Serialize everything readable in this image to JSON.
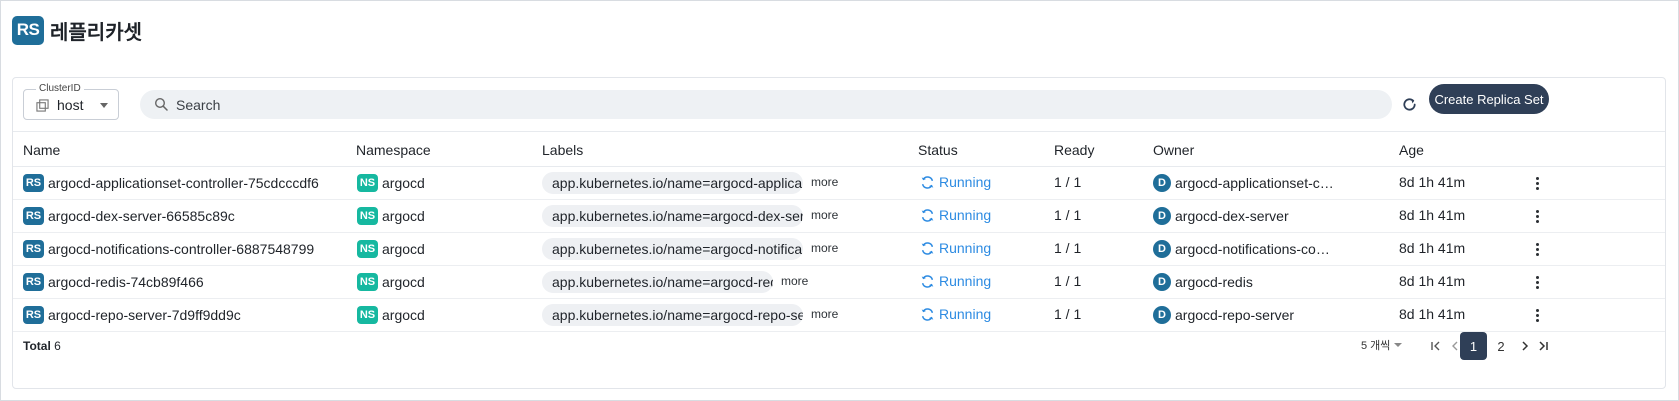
{
  "page": {
    "logo": "RS",
    "title": "레플리카셋"
  },
  "toolbar": {
    "cluster_label": "ClusterID",
    "cluster_value": "host",
    "search_placeholder": "Search",
    "create_label": "Create Replica Set"
  },
  "table": {
    "columns": [
      "Name",
      "Namespace",
      "Labels",
      "Status",
      "Ready",
      "Owner",
      "Age"
    ],
    "more_label": "more",
    "rows": [
      {
        "badge": "RS",
        "name": "argocd-applicationset-controller-75cdcccdf6",
        "ns_badge": "NS",
        "namespace": "argocd",
        "label": "app.kubernetes.io/name=argocd-applica…",
        "status": "Running",
        "ready": "1 / 1",
        "owner_badge": "D",
        "owner": "argocd-applicationset-c…",
        "age": "8d 1h 41m"
      },
      {
        "badge": "RS",
        "name": "argocd-dex-server-66585c89c",
        "ns_badge": "NS",
        "namespace": "argocd",
        "label": "app.kubernetes.io/name=argocd-dex-ser…",
        "status": "Running",
        "ready": "1 / 1",
        "owner_badge": "D",
        "owner": "argocd-dex-server",
        "age": "8d 1h 41m"
      },
      {
        "badge": "RS",
        "name": "argocd-notifications-controller-6887548799",
        "ns_badge": "NS",
        "namespace": "argocd",
        "label": "app.kubernetes.io/name=argocd-notifica…",
        "status": "Running",
        "ready": "1 / 1",
        "owner_badge": "D",
        "owner": "argocd-notifications-co…",
        "age": "8d 1h 41m"
      },
      {
        "badge": "RS",
        "name": "argocd-redis-74cb89f466",
        "ns_badge": "NS",
        "namespace": "argocd",
        "label": "app.kubernetes.io/name=argocd-redis",
        "status": "Running",
        "ready": "1 / 1",
        "owner_badge": "D",
        "owner": "argocd-redis",
        "age": "8d 1h 41m"
      },
      {
        "badge": "RS",
        "name": "argocd-repo-server-7d9ff9dd9c",
        "ns_badge": "NS",
        "namespace": "argocd",
        "label": "app.kubernetes.io/name=argocd-repo-se…",
        "status": "Running",
        "ready": "1 / 1",
        "owner_badge": "D",
        "owner": "argocd-repo-server",
        "age": "8d 1h 41m"
      }
    ]
  },
  "footer": {
    "total_label": "Total",
    "total_count": "6",
    "per_page": "5 개씩",
    "pages": [
      "1",
      "2"
    ],
    "current_page": "1"
  },
  "colors": {
    "brand": "#1f6e99",
    "namespace": "#16b8a0",
    "running": "#2d8be2",
    "primary_button": "#2f3f57"
  }
}
